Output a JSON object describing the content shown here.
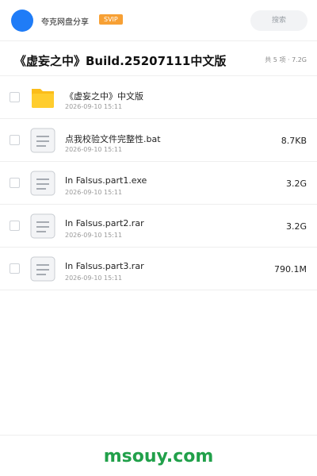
{
  "header": {
    "owner_name": "夸克网盘分享",
    "badge": "SVIP",
    "search_placeholder": "搜索"
  },
  "share": {
    "title": "《虚妄之中》Build.25207111中文版",
    "summary": "共 5 项 · 7.2G"
  },
  "files": [
    {
      "icon": "folder-icon",
      "name": "《虚妄之中》中文版",
      "date": "2026-09-10 15:11",
      "size": ""
    },
    {
      "icon": "file-icon",
      "name": "点我校验文件完整性.bat",
      "date": "2026-09-10 15:11",
      "size": "8.7KB"
    },
    {
      "icon": "file-icon",
      "name": "In Falsus.part1.exe",
      "date": "2026-09-10 15:11",
      "size": "3.2G"
    },
    {
      "icon": "file-icon",
      "name": "In Falsus.part2.rar",
      "date": "2026-09-10 15:11",
      "size": "3.2G"
    },
    {
      "icon": "file-icon",
      "name": "In Falsus.part3.rar",
      "date": "2026-09-10 15:11",
      "size": "790.1M"
    }
  ],
  "watermark": "msouy.com",
  "colors": {
    "avatar": "#1f7cf7",
    "svip": "#f7a034",
    "folder": "#fbbd1a",
    "watermark": "#21a04a"
  }
}
